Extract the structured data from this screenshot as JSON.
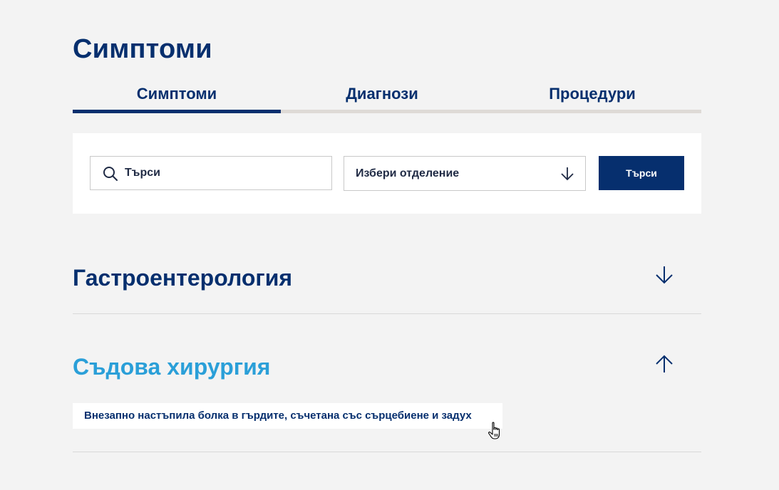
{
  "page": {
    "title": "Симптоми"
  },
  "tabs": [
    {
      "label": "Симптоми",
      "active": true
    },
    {
      "label": "Диагнози",
      "active": false
    },
    {
      "label": "Процедури",
      "active": false
    }
  ],
  "search": {
    "placeholder": "Търси",
    "department_placeholder": "Избери отделение",
    "button_label": "Търси"
  },
  "sections": [
    {
      "title": "Гастроентерология",
      "expanded": false
    },
    {
      "title": "Съдова хирургия",
      "expanded": true,
      "items": [
        "Внезапно настъпила болка в гърдите, съчетана със сърцебиене и задух"
      ]
    }
  ],
  "colors": {
    "primary": "#062f6e",
    "accent": "#2a9fd8",
    "background": "#f3f3f3",
    "tab_track": "#dedad6"
  }
}
